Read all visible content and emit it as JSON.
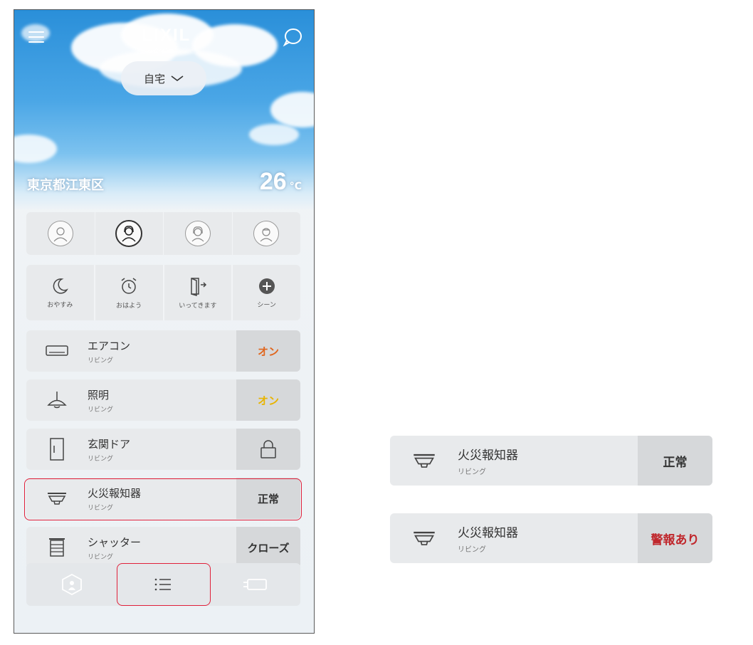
{
  "header": {
    "logo": "LIXIL",
    "home_selector": "自宅",
    "location": "東京都江東区",
    "temperature": "26",
    "temperature_unit": "°C"
  },
  "members": [
    {
      "name": "member-1",
      "active": false
    },
    {
      "name": "member-2",
      "active": true
    },
    {
      "name": "member-3",
      "active": false
    },
    {
      "name": "member-4",
      "active": false
    }
  ],
  "scenes": [
    {
      "label": "おやすみ",
      "icon": "moon-icon"
    },
    {
      "label": "おはよう",
      "icon": "alarm-clock-icon"
    },
    {
      "label": "いってきます",
      "icon": "door-exit-icon"
    },
    {
      "label": "シーン",
      "icon": "plus-circle-icon"
    }
  ],
  "devices": [
    {
      "name": "エアコン",
      "room": "リビング",
      "state": "オン",
      "state_color": "#e0661e",
      "icon": "air-conditioner-icon"
    },
    {
      "name": "照明",
      "room": "リビング",
      "state": "オン",
      "state_color": "#e8b400",
      "icon": "pendant-lamp-icon"
    },
    {
      "name": "玄関ドア",
      "room": "リビング",
      "state": "",
      "icon": "door-icon",
      "state_icon": "lock-icon"
    },
    {
      "name": "火災報知器",
      "room": "リビング",
      "state": "正常",
      "state_color": "#333333",
      "icon": "smoke-detector-icon"
    },
    {
      "name": "シャッター",
      "room": "リビング",
      "state": "クローズ",
      "state_color": "#333333",
      "icon": "shutter-icon"
    }
  ],
  "bottom_nav": [
    {
      "icon": "house-map-icon"
    },
    {
      "icon": "list-icon"
    },
    {
      "icon": "device-icon"
    }
  ],
  "side_examples": [
    {
      "name": "火災報知器",
      "room": "リビング",
      "state": "正常",
      "state_color": "#333333"
    },
    {
      "name": "火災報知器",
      "room": "リビング",
      "state": "警報あり",
      "state_color": "#c0282d"
    }
  ],
  "colors": {
    "highlight": "#e0203a",
    "card_bg": "#e8eaec",
    "state_bg": "#d6d8da"
  }
}
